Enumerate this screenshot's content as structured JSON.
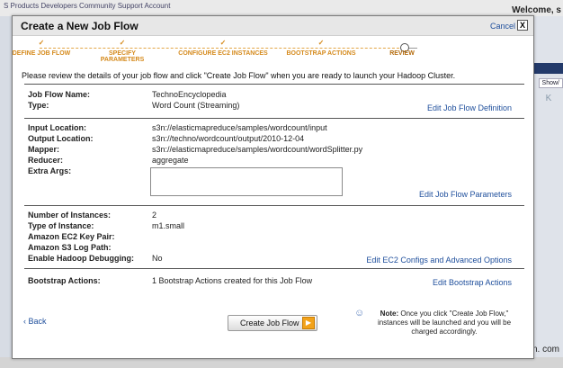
{
  "background": {
    "nav_text": "S  Products  Developers  Community  Support  Account",
    "welcome_text": "Welcome, s",
    "show_label": "Show/",
    "pager_label": "K",
    "footer_text": "As amazon.com. com"
  },
  "modal": {
    "title": "Create a New Job Flow",
    "cancel_label": "Cancel",
    "close_label": "X"
  },
  "steps": [
    {
      "label": "DEFINE JOB FLOW",
      "done": true
    },
    {
      "label": "SPECIFY PARAMETERS",
      "done": true
    },
    {
      "label": "CONFIGURE EC2 INSTANCES",
      "done": true
    },
    {
      "label": "BOOTSTRAP ACTIONS",
      "done": true
    },
    {
      "label": "REVIEW",
      "done": false,
      "current": true
    }
  ],
  "intro_text": "Please review the details of your job flow and click \"Create Job Flow\" when you are ready to launch your Hadoop Cluster.",
  "section_definition": {
    "job_flow_name_label": "Job Flow Name:",
    "job_flow_name": "TechnoEncyclopedia",
    "type_label": "Type:",
    "type": "Word Count (Streaming)",
    "edit_label": "Edit Job Flow Definition"
  },
  "section_parameters": {
    "input_label": "Input Location:",
    "input": "s3n://elasticmapreduce/samples/wordcount/input",
    "output_label": "Output Location:",
    "output": "s3n://techno/wordcount/output/2010-12-04",
    "mapper_label": "Mapper:",
    "mapper": "s3n://elasticmapreduce/samples/wordcount/wordSplitter.py",
    "reducer_label": "Reducer:",
    "reducer": "aggregate",
    "extra_args_label": "Extra Args:",
    "extra_args": "",
    "edit_label": "Edit Job Flow Parameters"
  },
  "section_instances": {
    "num_instances_label": "Number of Instances:",
    "num_instances": "2",
    "instance_type_label": "Type of Instance:",
    "instance_type": "m1.small",
    "key_pair_label": "Amazon EC2 Key Pair:",
    "key_pair": "",
    "log_path_label": "Amazon S3 Log Path:",
    "log_path": "",
    "debugging_label": "Enable Hadoop Debugging:",
    "debugging": "No",
    "edit_label": "Edit EC2 Configs and Advanced Options"
  },
  "section_bootstrap": {
    "label": "Bootstrap Actions:",
    "value": "1 Bootstrap Actions created for this Job Flow",
    "edit_label": "Edit Bootstrap Actions"
  },
  "footer": {
    "back_label": "Back",
    "create_label": "Create Job Flow",
    "note_title": "Note:",
    "note_text": "Once you click \"Create Job Flow,\" instances will be launched and you will be charged accordingly."
  },
  "colors": {
    "link": "#1f4f9c",
    "step": "#d58a1c",
    "button_arrow": "#f2a21a"
  }
}
